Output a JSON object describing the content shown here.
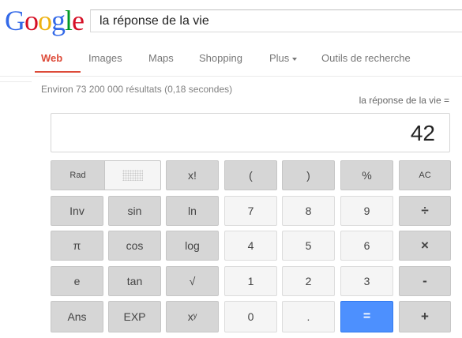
{
  "logo": {
    "letters": [
      "G",
      "o",
      "o",
      "g",
      "l",
      "e"
    ],
    "colors": [
      "#3369e8",
      "#d50f25",
      "#eeb211",
      "#3369e8",
      "#009925",
      "#d50f25"
    ]
  },
  "search": {
    "value": "la réponse de la vie"
  },
  "nav": {
    "items": [
      {
        "label": "Web",
        "active": true
      },
      {
        "label": "Images"
      },
      {
        "label": "Maps"
      },
      {
        "label": "Shopping"
      },
      {
        "label": "Plus"
      },
      {
        "label": "Outils de recherche"
      }
    ]
  },
  "results_stats": "Environ 73 200 000 résultats (0,18 secondes)",
  "calculator": {
    "query": "la réponse de la vie =",
    "display": "42",
    "rad_label": "Rad",
    "keys": [
      [
        "x!",
        "(",
        ")",
        "%",
        "AC"
      ],
      [
        "Inv",
        "sin",
        "ln",
        "7",
        "8",
        "9",
        "÷"
      ],
      [
        "π",
        "cos",
        "log",
        "4",
        "5",
        "6",
        "×"
      ],
      [
        "e",
        "tan",
        "√",
        "1",
        "2",
        "3",
        "-"
      ],
      [
        "Ans",
        "EXP",
        "xʸ",
        "0",
        ".",
        "=",
        "+"
      ]
    ]
  }
}
